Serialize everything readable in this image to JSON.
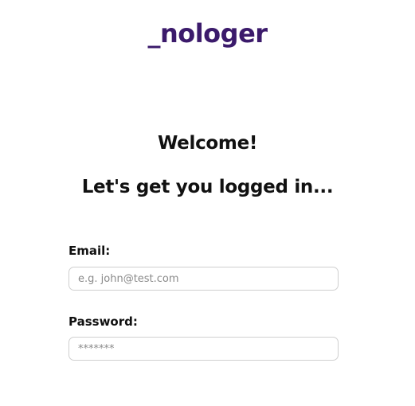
{
  "brand": {
    "logo_text": "_nologer",
    "logo_color": "#3b1a6b"
  },
  "login": {
    "welcome": "Welcome!",
    "subtitle": "Let's get you logged in...",
    "email": {
      "label": "Email:",
      "placeholder": "e.g. john@test.com",
      "value": ""
    },
    "password": {
      "label": "Password:",
      "placeholder": "*******",
      "value": ""
    }
  }
}
